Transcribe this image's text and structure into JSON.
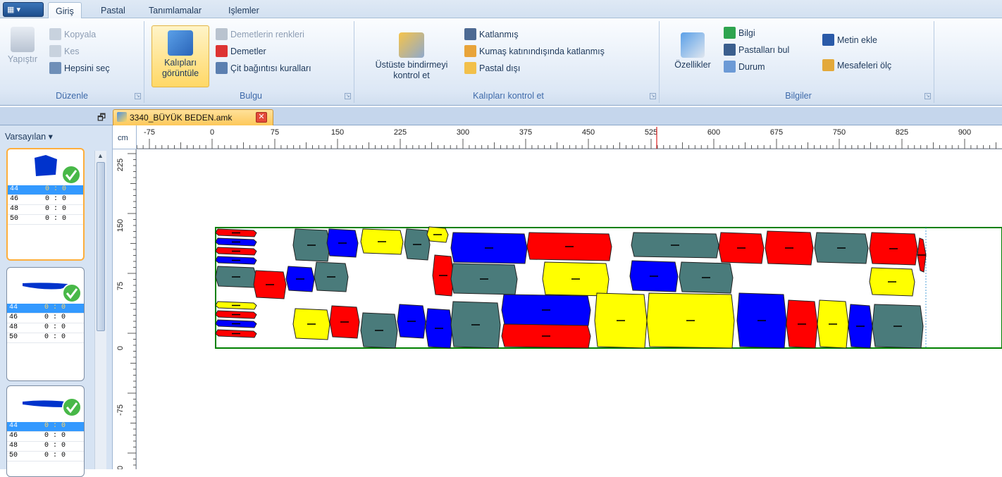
{
  "app": {
    "menu_label": "▾"
  },
  "tabs": [
    "Giriş",
    "Pastal",
    "Tanımlamalar",
    "Işlemler"
  ],
  "ribbon": {
    "duzenle": {
      "title": "Düzenle",
      "paste": "Yapıştır",
      "copy": "Kopyala",
      "cut": "Kes",
      "select_all": "Hepsini seç"
    },
    "bulgu": {
      "title": "Bulgu",
      "show_patterns_1": "Kalıpları",
      "show_patterns_2": "görüntüle",
      "bundle_colors": "Demetlerin renkleri",
      "bundles": "Demetler",
      "pair_rules": "Çit bağıntısı kuralları"
    },
    "kontrol": {
      "title": "Kalıpları kontrol et",
      "overlap_1": "Üstüste bindirmeyi",
      "overlap_2": "kontrol et",
      "folded": "Katlanmış",
      "fabric_fold": "Kumaş katınındışında katlanmış",
      "outside": "Pastal dışı"
    },
    "bilgiler": {
      "title": "Bilgiler",
      "properties": "Özellikler",
      "info": "Bilgi",
      "find_markers": "Pastalları bul",
      "status": "Durum",
      "add_text": "Metin ekle",
      "measure": "Mesafeleri ölç"
    }
  },
  "document": {
    "tab_title": "3340_BÜYÜK BEDEN.amk",
    "close": "✕"
  },
  "panel": {
    "title": "Varsayılan",
    "cards": [
      {
        "sizes": [
          {
            "size": "44",
            "count": "0 : 0"
          },
          {
            "size": "46",
            "count": "0 : 0"
          },
          {
            "size": "48",
            "count": "0 : 0"
          },
          {
            "size": "50",
            "count": "0 : 0"
          }
        ]
      },
      {
        "sizes": [
          {
            "size": "44",
            "count": "0 : 0"
          },
          {
            "size": "46",
            "count": "0 : 0"
          },
          {
            "size": "48",
            "count": "0 : 0"
          },
          {
            "size": "50",
            "count": "0 : 0"
          }
        ]
      },
      {
        "sizes": [
          {
            "size": "44",
            "count": "0 : 0"
          },
          {
            "size": "46",
            "count": "0 : 0"
          },
          {
            "size": "48",
            "count": "0 : 0"
          },
          {
            "size": "50",
            "count": "0 : 0"
          }
        ]
      }
    ]
  },
  "ruler": {
    "unit": "cm",
    "h_labels": [
      "-75",
      "0",
      "75",
      "150",
      "225",
      "300",
      "375",
      "450",
      "525",
      "600",
      "675",
      "750",
      "825",
      "900"
    ],
    "v_labels": [
      "225",
      "150",
      "75",
      "0",
      "-75",
      "0"
    ]
  },
  "colors": {
    "red": "#ff0000",
    "blue": "#0000ff",
    "yellow": "#ffff00",
    "teal": "#4a7b7b",
    "marker_border": "#008000"
  }
}
